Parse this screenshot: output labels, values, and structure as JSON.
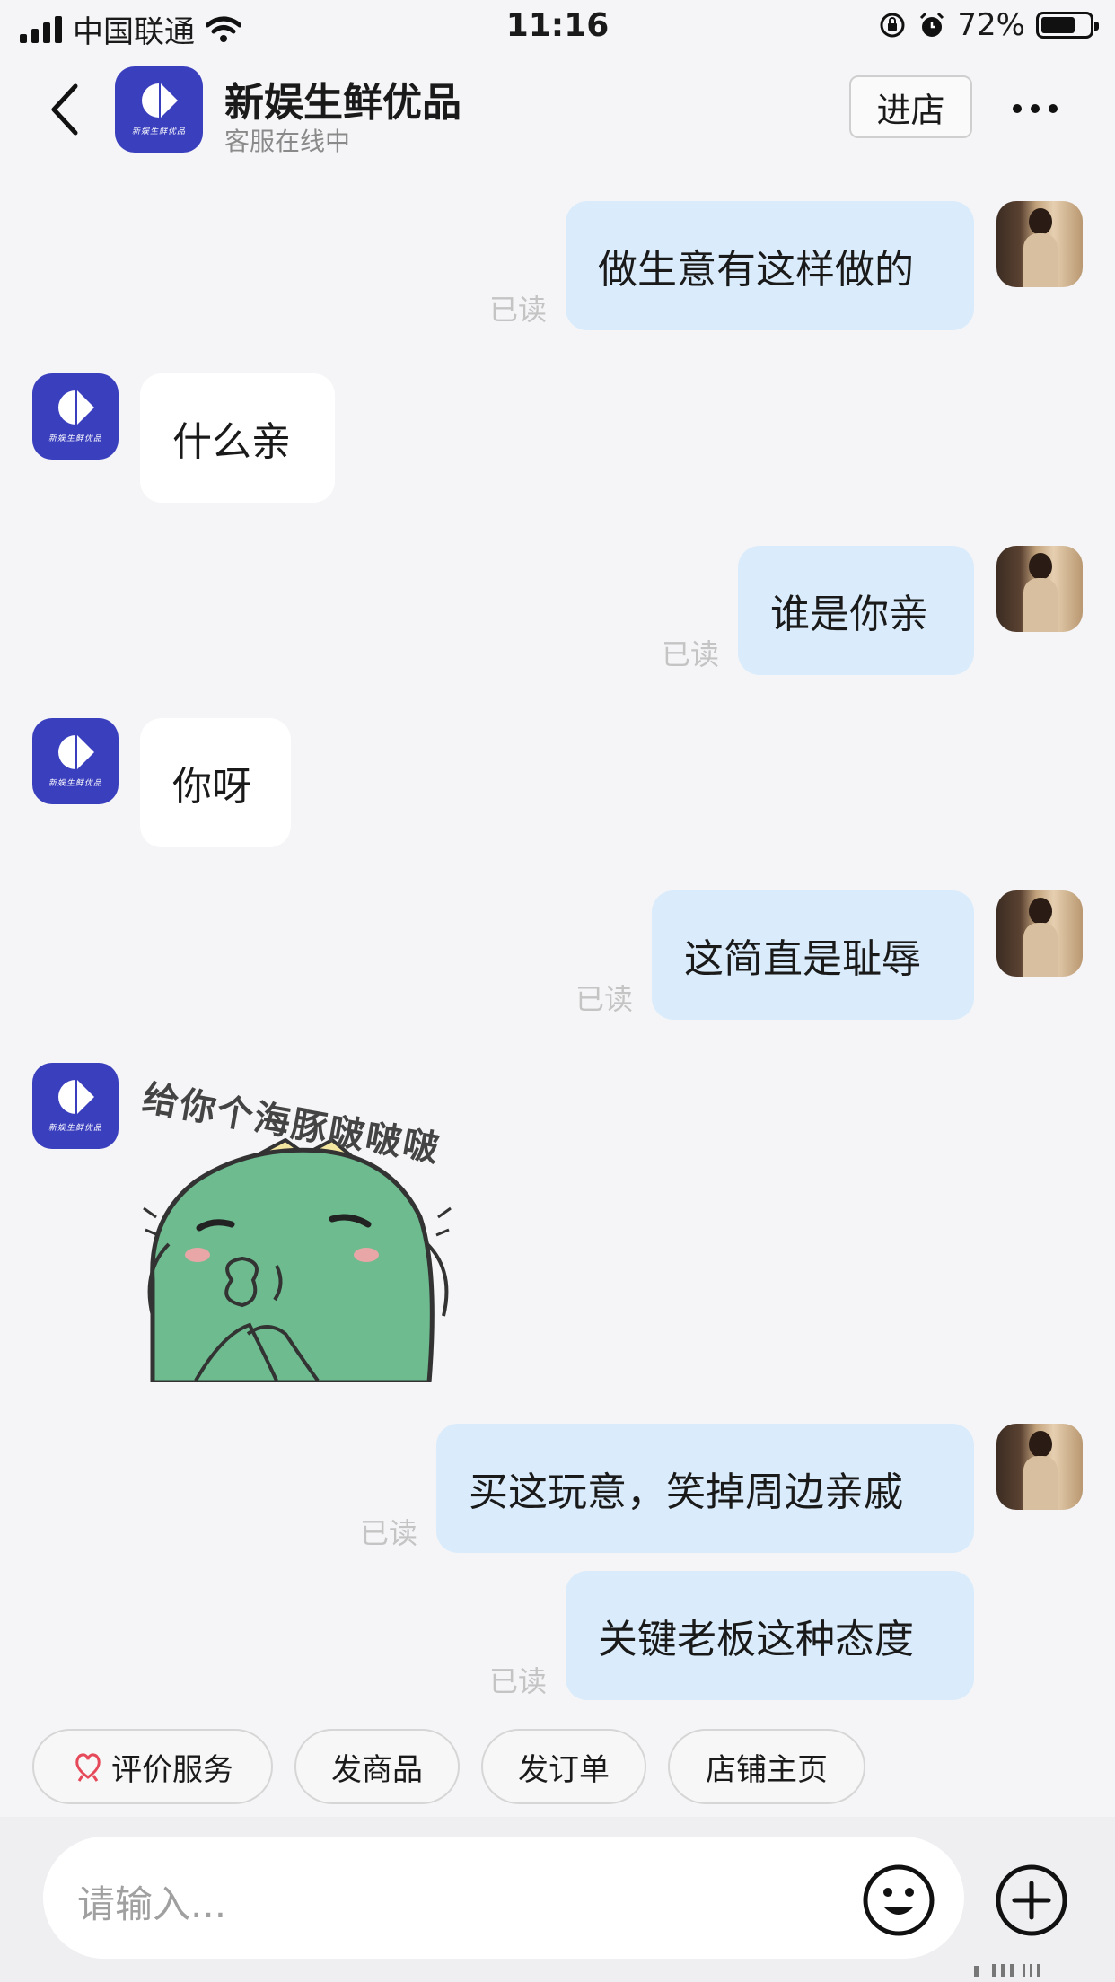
{
  "status_bar": {
    "carrier": "中国联通",
    "time": "11:16",
    "battery": "72%",
    "battery_level": 0.72
  },
  "header": {
    "shop_name": "新娱生鲜优品",
    "status": "客服在线中",
    "enter_store_label": "进店",
    "logo_text": "新娱生鲜优品"
  },
  "messages": [
    {
      "from": "me",
      "text": "做生意有这样做的",
      "read": "已读"
    },
    {
      "from": "shop",
      "text": "什么亲"
    },
    {
      "from": "me",
      "text": "谁是你亲",
      "read": "已读"
    },
    {
      "from": "shop",
      "text": "你呀"
    },
    {
      "from": "me",
      "text": "这简直是耻辱",
      "read": "已读"
    },
    {
      "from": "shop",
      "type": "sticker",
      "text": "给你个海豚啵啵啵"
    },
    {
      "from": "me",
      "text": "买这玩意，笑掉周边亲戚",
      "read": "已读"
    },
    {
      "from": "me",
      "text": "关键老板这种态度",
      "read": "已读"
    }
  ],
  "quick_actions": [
    {
      "label": "评价服务",
      "icon": "heart-hands-icon"
    },
    {
      "label": "发商品"
    },
    {
      "label": "发订单"
    },
    {
      "label": "店铺主页"
    }
  ],
  "input": {
    "placeholder": "请输入..."
  },
  "colors": {
    "brand": "#3a3fbe",
    "my_bubble": "#daecfb",
    "shop_bubble": "#ffffff",
    "read_text": "#c4c4c4",
    "sticker_green": "#6dbb8f"
  }
}
